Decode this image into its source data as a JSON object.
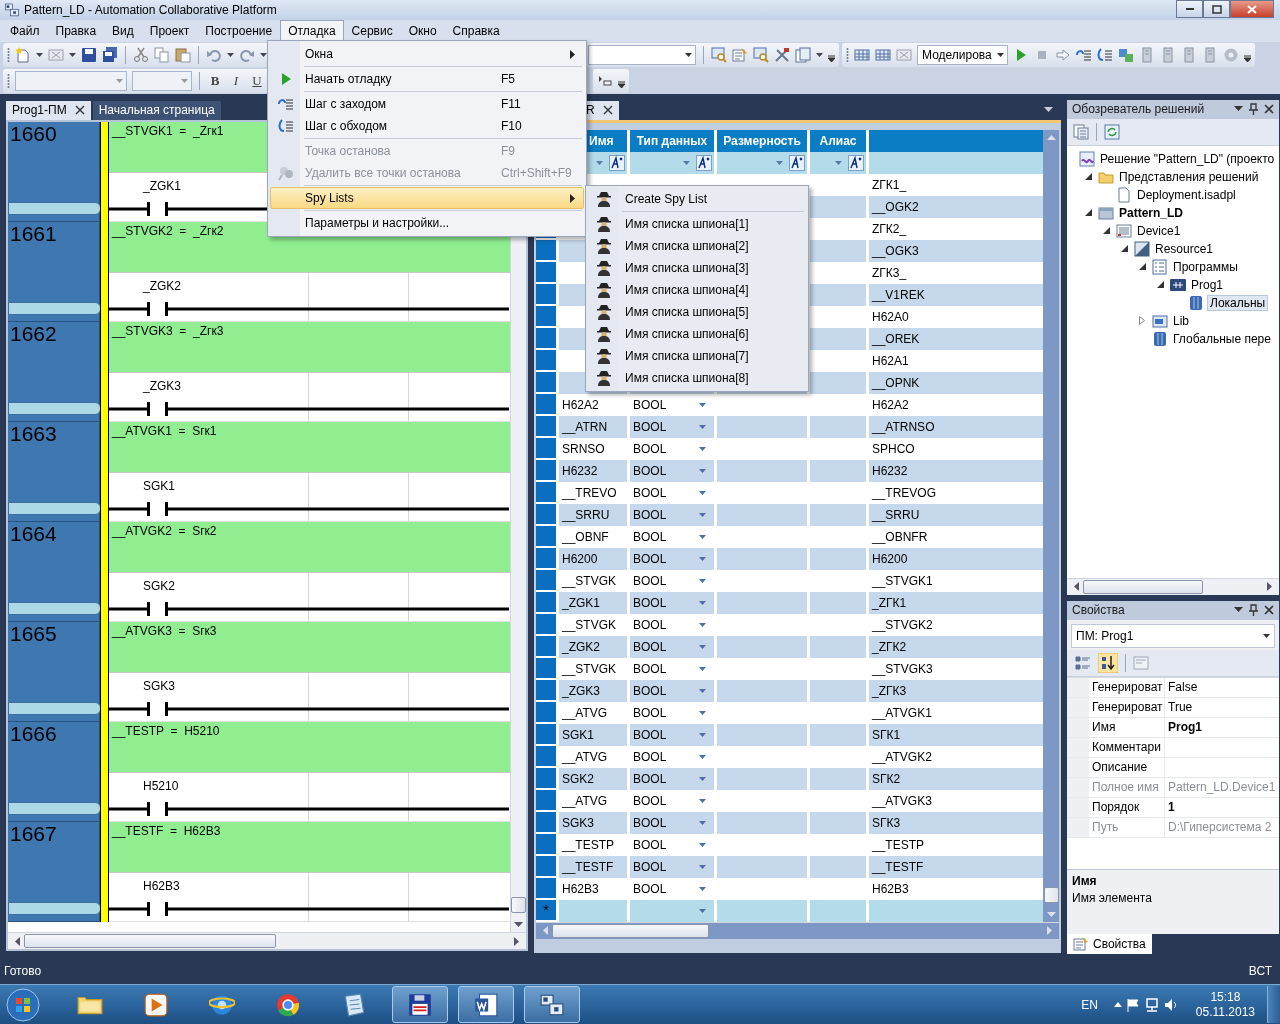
{
  "window": {
    "title": "Pattern_LD - Automation Collaborative Platform"
  },
  "menu_bar": [
    {
      "label": "Файл",
      "selected": false
    },
    {
      "label": "Правка",
      "selected": false
    },
    {
      "label": "Вид",
      "selected": false
    },
    {
      "label": "Проект",
      "selected": false
    },
    {
      "label": "Построение",
      "selected": false
    },
    {
      "label": "Отладка",
      "selected": true
    },
    {
      "label": "Сервис",
      "selected": false
    },
    {
      "label": "Окно",
      "selected": false
    },
    {
      "label": "Справка",
      "selected": false
    }
  ],
  "toolbar": {
    "format_buttons": [
      "B",
      "I",
      "U"
    ],
    "configuration": "Моделирова"
  },
  "debug_menu": [
    {
      "kind": "submenu",
      "label": "Окна",
      "disabled": false,
      "selected": false
    },
    {
      "kind": "separator"
    },
    {
      "kind": "item",
      "label": "Начать отладку",
      "shortcut": "F5",
      "disabled": false,
      "selected": false
    },
    {
      "kind": "separator"
    },
    {
      "kind": "item",
      "label": "Шаг с заходом",
      "shortcut": "F11",
      "disabled": false,
      "selected": false
    },
    {
      "kind": "item",
      "label": "Шаг с обходом",
      "shortcut": "F10",
      "disabled": false,
      "selected": false
    },
    {
      "kind": "separator"
    },
    {
      "kind": "item",
      "label": "Точка останова",
      "shortcut": "F9",
      "disabled": true,
      "selected": false
    },
    {
      "kind": "item",
      "label": "Удалить все точки останова",
      "shortcut": "Ctrl+Shift+F9",
      "disabled": true,
      "selected": false
    },
    {
      "kind": "separator"
    },
    {
      "kind": "submenu",
      "label": "Spy Lists",
      "disabled": false,
      "selected": true
    },
    {
      "kind": "separator"
    },
    {
      "kind": "item",
      "label": "Параметры и настройки...",
      "disabled": false,
      "selected": false
    }
  ],
  "spy_menu": [
    {
      "kind": "item",
      "label": "Create Spy List",
      "selected": false
    },
    {
      "kind": "separator"
    },
    {
      "kind": "item",
      "label": "Имя списка шпиона[1]",
      "selected": false
    },
    {
      "kind": "item",
      "label": "Имя списка шпиона[2]",
      "selected": false
    },
    {
      "kind": "item",
      "label": "Имя списка шпиона[3]",
      "selected": false
    },
    {
      "kind": "item",
      "label": "Имя списка шпиона[4]",
      "selected": false
    },
    {
      "kind": "item",
      "label": "Имя списка шпиона[5]",
      "selected": false
    },
    {
      "kind": "item",
      "label": "Имя списка шпиона[6]",
      "selected": false
    },
    {
      "kind": "item",
      "label": "Имя списка шпиона[7]",
      "selected": false
    },
    {
      "kind": "item",
      "label": "Имя списка шпиона[8]",
      "selected": false
    }
  ],
  "editor_tabs": [
    {
      "label": "Prog1-ПМ",
      "selected": true,
      "closable": true
    },
    {
      "label": "Начальная страница",
      "selected": false,
      "closable": false
    }
  ],
  "ladder": {
    "rungs": [
      {
        "number": "1660",
        "coil": "__STVGK1  =  _Zгк1",
        "contact": "_ZGK1"
      },
      {
        "number": "1661",
        "coil": "__STVGK2  =  _Zгк2",
        "contact": "_ZGK2"
      },
      {
        "number": "1662",
        "coil": "__STVGK3  =  _Zгк3",
        "contact": "_ZGK3"
      },
      {
        "number": "1663",
        "coil": "__ATVGK1  =  Sгк1",
        "contact": "SGK1"
      },
      {
        "number": "1664",
        "coil": "__ATVGK2  =  Sгк2",
        "contact": "SGK2"
      },
      {
        "number": "1665",
        "coil": "__ATVGK3  =  Sгк3",
        "contact": "SGK3"
      },
      {
        "number": "1666",
        "coil": "__TESTP  =  H5210",
        "contact": "H5210"
      },
      {
        "number": "1667",
        "coil": "__TESTF  =  H62B3",
        "contact": "H62B3"
      }
    ]
  },
  "variables_panel": {
    "tab": {
      "label": "R",
      "selected": true
    },
    "table": {
      "columns": [
        "Имя",
        "Тип данных",
        "Размерность",
        "Алиас"
      ],
      "rows": [
        {
          "column_5": "ZГК1_"
        },
        {
          "column_5": "__OGK2"
        },
        {
          "column_5": "ZГК2_"
        },
        {
          "column_5": "__OGK3"
        },
        {
          "column_5": "ZГК3_"
        },
        {
          "column_5": "__V1REK"
        },
        {
          "column_5": "H62A0"
        },
        {
          "column_5": "__OREK"
        },
        {
          "column_5": "H62A1"
        },
        {
          "column_5": "__OPNK"
        },
        {
          "name": "H62A2",
          "type": "BOOL",
          "column_5": "H62A2"
        },
        {
          "name": "__ATRN",
          "type": "BOOL",
          "column_5": "__ATRNSO"
        },
        {
          "name": "SRNSO",
          "type": "BOOL",
          "column_5": "SPHCO"
        },
        {
          "name": "H6232",
          "type": "BOOL",
          "column_5": "H6232"
        },
        {
          "name": "__TREVO",
          "type": "BOOL",
          "column_5": "__TREVOG"
        },
        {
          "name": "__SRRU",
          "type": "BOOL",
          "column_5": "__SRRU"
        },
        {
          "name": "__OBNF",
          "type": "BOOL",
          "column_5": "__OBNFR"
        },
        {
          "name": "H6200",
          "type": "BOOL",
          "column_5": "H6200"
        },
        {
          "name": "__STVGK",
          "type": "BOOL",
          "column_5": "__STVGK1"
        },
        {
          "name": "_ZGK1",
          "type": "BOOL",
          "column_5": "_ZГК1"
        },
        {
          "name": "__STVGK",
          "type": "BOOL",
          "column_5": "__STVGK2"
        },
        {
          "name": "_ZGK2",
          "type": "BOOL",
          "column_5": "_ZГК2"
        },
        {
          "name": "__STVGK",
          "type": "BOOL",
          "column_5": "__STVGK3"
        },
        {
          "name": "_ZGK3",
          "type": "BOOL",
          "column_5": "_ZГК3"
        },
        {
          "name": "__ATVG",
          "type": "BOOL",
          "column_5": "__ATVGK1"
        },
        {
          "name": "SGK1",
          "type": "BOOL",
          "column_5": "SГК1"
        },
        {
          "name": "__ATVG",
          "type": "BOOL",
          "column_5": "__ATVGK2"
        },
        {
          "name": "SGK2",
          "type": "BOOL",
          "column_5": "SГК2"
        },
        {
          "name": "__ATVG",
          "type": "BOOL",
          "column_5": "__ATVGK3"
        },
        {
          "name": "SGK3",
          "type": "BOOL",
          "column_5": "SГК3"
        },
        {
          "name": "__TESTP",
          "type": "BOOL",
          "column_5": "__TESTP"
        },
        {
          "name": "__TESTF",
          "type": "BOOL",
          "column_5": "__TESTF"
        },
        {
          "name": "H62B3",
          "type": "BOOL",
          "column_5": "H62B3"
        }
      ],
      "new_row_marker": "*"
    }
  },
  "solution_explorer": {
    "title": "Обозреватель решений",
    "tree": [
      {
        "label": "Решение \"Pattern_LD\"  (проекто",
        "kind": "solution",
        "selected": false,
        "startup": false,
        "children": [
          {
            "label": "Представления решений",
            "kind": "folder",
            "expanded": true,
            "selected": false,
            "startup": false,
            "children": [
              {
                "label": "Deployment.isadpl",
                "kind": "file",
                "selected": false,
                "startup": false
              }
            ]
          },
          {
            "label": "Pattern_LD",
            "kind": "project",
            "expanded": true,
            "selected": false,
            "startup": true,
            "children": [
              {
                "label": "Device1",
                "kind": "device",
                "expanded": true,
                "selected": false,
                "startup": false,
                "children": [
                  {
                    "label": "Resource1",
                    "kind": "resource",
                    "expanded": true,
                    "selected": false,
                    "startup": false,
                    "children": [
                      {
                        "label": "Программы",
                        "kind": "programs",
                        "expanded": true,
                        "selected": false,
                        "startup": false,
                        "children": [
                          {
                            "label": "Prog1",
                            "kind": "program",
                            "expanded": true,
                            "selected": false,
                            "startup": false,
                            "children": [
                              {
                                "label": "Локальны",
                                "kind": "variables",
                                "selected": true,
                                "startup": false
                              }
                            ]
                          }
                        ]
                      },
                      {
                        "label": "Lib",
                        "kind": "library",
                        "expanded": false,
                        "selected": false,
                        "startup": false
                      },
                      {
                        "label": "Глобальные пере",
                        "kind": "variables",
                        "selected": false,
                        "startup": false
                      }
                    ]
                  }
                ]
              }
            ]
          }
        ]
      }
    ]
  },
  "properties": {
    "title": "Свойства",
    "object": "ПМ: Prog1",
    "sort_modes": [
      {
        "selected": false
      },
      {
        "selected": true
      }
    ],
    "rows": [
      {
        "name": "Генерироват",
        "value": "False",
        "disabled": false,
        "modified": false
      },
      {
        "name": "Генерироват",
        "value": "True",
        "disabled": false,
        "modified": false
      },
      {
        "name": "Имя",
        "value": "Prog1",
        "disabled": false,
        "modified": true
      },
      {
        "name": "Комментари",
        "disabled": false
      },
      {
        "name": "Описание",
        "disabled": false
      },
      {
        "name": "Полное имя",
        "value": "Pattern_LD.Device1",
        "disabled": true,
        "modified": false
      },
      {
        "name": "Порядок",
        "value": "1",
        "disabled": false,
        "modified": true
      },
      {
        "name": "Путь",
        "value": "D:\\Гиперсистема 2",
        "disabled": true,
        "modified": false
      }
    ],
    "description": {
      "title": "Имя",
      "text": "Имя элемента"
    },
    "tab": "Свойства"
  },
  "status_bar": {
    "text": "Готово",
    "mode": "ВСТ"
  },
  "taskbar": {
    "apps": [
      {
        "active": false
      },
      {
        "active": false
      },
      {
        "active": false
      },
      {
        "active": false
      },
      {
        "active": false
      },
      {
        "active": true
      },
      {
        "active": true
      },
      {
        "active": true
      }
    ],
    "language": "EN",
    "time": "15:18",
    "date": "05.11.2013"
  }
}
